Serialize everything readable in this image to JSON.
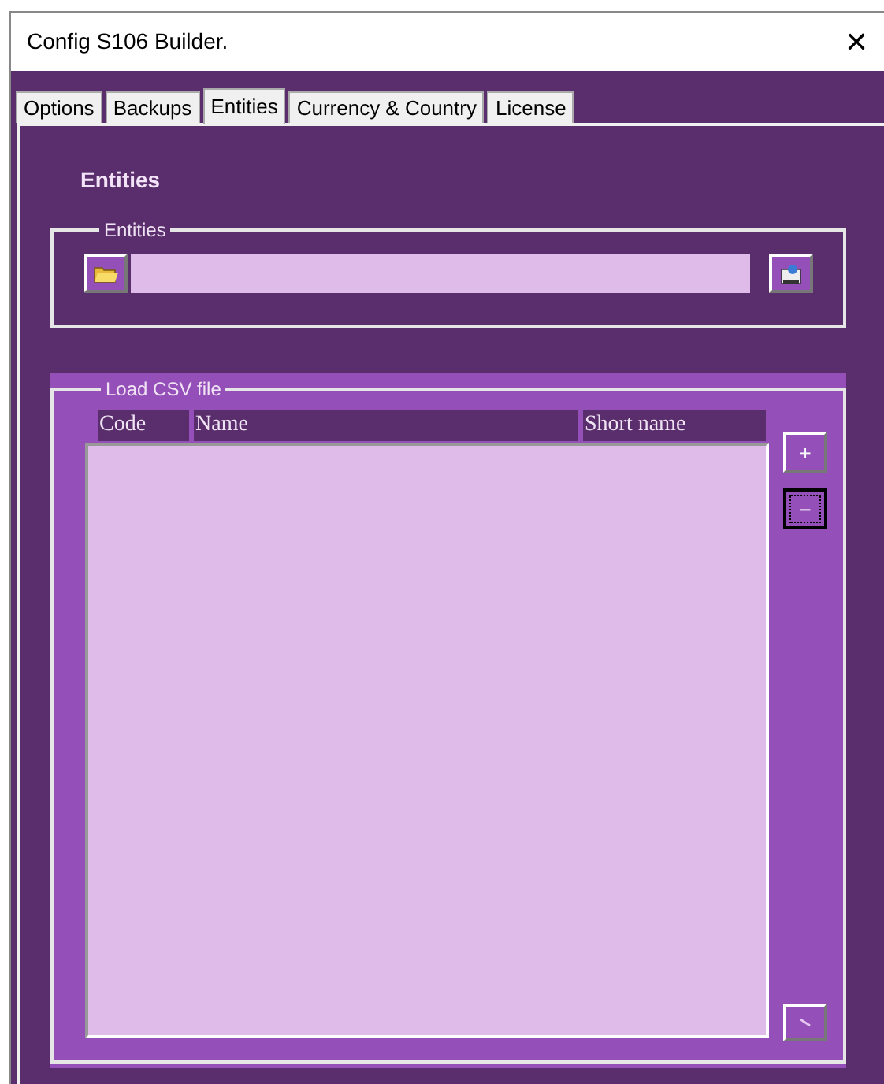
{
  "window": {
    "title": "Config S106 Builder.",
    "close": "✕"
  },
  "tabs": [
    {
      "label": "Options",
      "selected": false
    },
    {
      "label": "Backups",
      "selected": false
    },
    {
      "label": "Entities",
      "selected": true
    },
    {
      "label": "Currency & Country",
      "selected": false
    },
    {
      "label": "License",
      "selected": false
    }
  ],
  "heading": "Entities",
  "entities_group": {
    "legend": "Entities"
  },
  "csv_group": {
    "legend": "Load CSV file",
    "columns": [
      "Code",
      "Name",
      "Short name"
    ],
    "buttons": [
      {
        "label": "+",
        "focused": false
      },
      {
        "label": "−",
        "focused": true
      }
    ]
  }
}
